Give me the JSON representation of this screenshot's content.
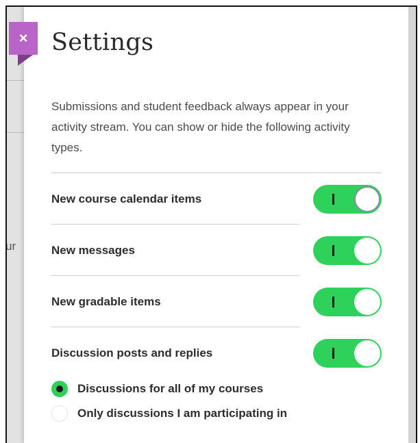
{
  "panel": {
    "title": "Settings",
    "close_glyph": "×",
    "intro": "Submissions and student feedback always appear in your activity stream. You can show or hide the following activity types."
  },
  "background": {
    "clipped_text": "ur"
  },
  "toggles": [
    {
      "label": "New course calendar items",
      "on_mark": "I",
      "state": "on"
    },
    {
      "label": "New messages",
      "on_mark": "I",
      "state": "on"
    },
    {
      "label": "New gradable items",
      "on_mark": "I",
      "state": "on"
    },
    {
      "label": "Discussion posts and replies",
      "on_mark": "I",
      "state": "on"
    }
  ],
  "discussion_options": [
    {
      "label": "Discussions for all of my courses",
      "selected": true
    },
    {
      "label": "Only discussions I am participating in",
      "selected": false
    }
  ],
  "colors": {
    "accent_green": "#2ed15a",
    "close_tab": "#b864c9"
  }
}
